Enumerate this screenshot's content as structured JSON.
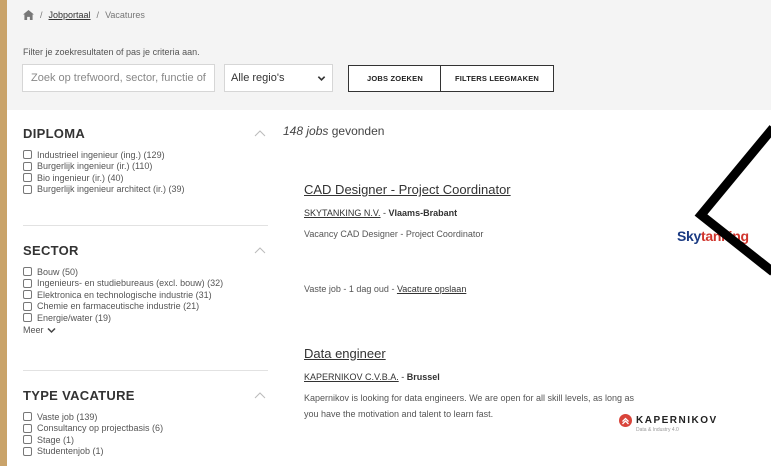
{
  "breadcrumb": {
    "items": [
      {
        "label": "Jobportaal",
        "link": true
      },
      {
        "label": "Vacatures",
        "link": false
      }
    ],
    "separator": "/"
  },
  "filter_bar": {
    "label": "Filter je zoekresultaten of pas je criteria aan.",
    "search_placeholder": "Zoek op trefwoord, sector, functie of",
    "region_value": "Alle regio's",
    "search_button": "JOBS ZOEKEN",
    "clear_button": "FILTERS LEEGMAKEN"
  },
  "facets": {
    "diploma": {
      "title": "DIPLOMA",
      "options": [
        "Industrieel ingenieur (ing.) (129)",
        "Burgerlijk ingenieur (ir.) (110)",
        "Bio ingenieur (ir.) (40)",
        "Burgerlijk ingenieur architect (ir.) (39)"
      ]
    },
    "sector": {
      "title": "SECTOR",
      "options": [
        "Bouw (50)",
        "Ingenieurs- en studiebureaus (excl. bouw) (32)",
        "Elektronica en technologische industrie (31)",
        "Chemie en farmaceutische industrie (21)",
        "Energie/water (19)"
      ],
      "more": "Meer"
    },
    "type": {
      "title": "TYPE VACATURE",
      "options": [
        "Vaste job (139)",
        "Consultancy op projectbasis (6)",
        "Stage (1)",
        "Studentenjob (1)"
      ]
    }
  },
  "results": {
    "count": "148",
    "count_unit": "jobs",
    "count_suffix": "gevonden",
    "jobs": [
      {
        "title": "CAD Designer - Project Coordinator",
        "company": "SKYTANKING N.V.",
        "location": "Vlaams-Brabant",
        "description": "Vacancy CAD Designer - Project Coordinator",
        "type": "Vaste job",
        "age": "1 dag oud",
        "save": "Vacature opslaan",
        "logo": {
          "text_main": "Sky",
          "text_accent": "tanking",
          "colors": {
            "main": "#1a3a82",
            "accent": "#d0342c"
          }
        }
      },
      {
        "title": "Data engineer",
        "company": "KAPERNIKOV C.V.B.A.",
        "location": "Brussel",
        "description": "Kapernikov is looking for data engineers. We are open for all skill levels, as long as you have the motivation and talent to learn fast.",
        "logo": {
          "text_main": "KAPERNIKOV",
          "text_sub": "Data & Industry 4.0",
          "colors": {
            "badge": "#d9443a"
          }
        }
      }
    ]
  },
  "icons": {
    "home": "home-icon",
    "select_chevron": "chevron-down-icon",
    "facet_toggle": "chevron-up-icon",
    "more_chevron": "chevron-down-icon",
    "overlay": "chevron-left-icon"
  }
}
